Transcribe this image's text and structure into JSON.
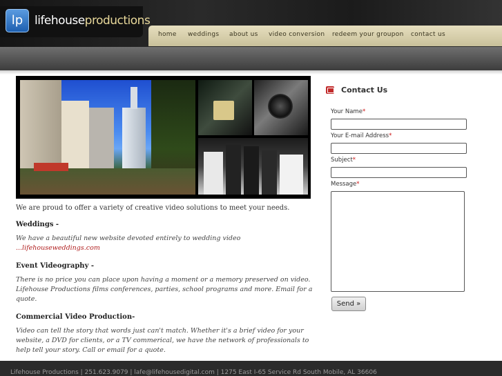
{
  "header": {
    "logo_mark": "lp",
    "logo_part1": "lifehouse",
    "logo_part2": "productions"
  },
  "nav": {
    "items": [
      "home",
      "weddings",
      "about us",
      "video conversion",
      "redeem your groupon",
      "contact us"
    ]
  },
  "main": {
    "intro": "We are proud to offer a variety of creative video solutions to meet your needs.",
    "sections": [
      {
        "heading": "Weddings -",
        "text": "We have a beautiful new website devoted entirely to wedding video",
        "link": "...lifehouseweddings.com"
      },
      {
        "heading": "Event Videography -",
        "text": "There is no price you can place upon having a moment or a memory preserved on video. Lifehouse Productions films conferences, parties, school programs and more. Email for a quote."
      },
      {
        "heading": "Commercial Video Production-",
        "text": "Video can tell the story that words just can't match. Whether it's a brief video for your website, a DVD for clients, or a TV commerical, we have the network of professionals to help tell your story. Call or email for a quote."
      }
    ]
  },
  "contact": {
    "title": "Contact Us",
    "name_label": "Your Name",
    "email_label": "Your E-mail Address",
    "subject_label": "Subject",
    "message_label": "Message",
    "required_mark": "*",
    "send_label": "Send »"
  },
  "footer": {
    "text": "Lifehouse Productions | 251.623.9079 | lafe@lifehousedigital.com | 1275 East I-65 Service Rd South Mobile, AL 36606"
  },
  "colors": {
    "accent_red": "#c12a2a",
    "nav_bg": "#d8d0ad",
    "link_red": "#b01e1e"
  }
}
